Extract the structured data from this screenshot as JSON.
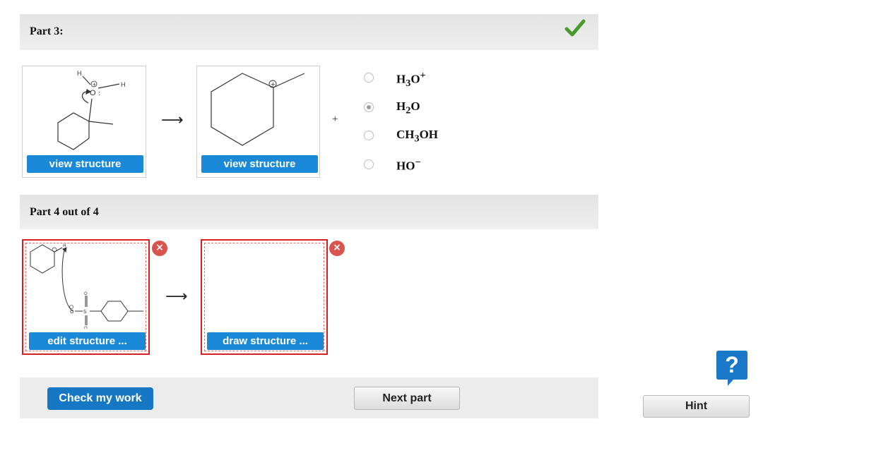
{
  "part3": {
    "title": "Part 3:",
    "reactant_button": "view structure",
    "product_button": "view structure",
    "arrow": "⟶",
    "plus": "+",
    "options": [
      {
        "base": "H",
        "sub": "3",
        "rest": "O",
        "sup": "+",
        "selected": false
      },
      {
        "base": "H",
        "sub": "2",
        "rest": "O",
        "sup": "",
        "selected": true
      },
      {
        "base": "CH",
        "sub": "3",
        "rest": "OH",
        "sup": "",
        "selected": false
      },
      {
        "base": "HO",
        "sub": "",
        "rest": "",
        "sup": "−",
        "selected": false
      }
    ]
  },
  "part4": {
    "title": "Part 4 out of 4",
    "edit_button": "edit structure ...",
    "draw_button": "draw structure ...",
    "arrow": "⟶",
    "remove_icon": "×"
  },
  "footer": {
    "check_button": "Check my work",
    "next_button": "Next part",
    "hint_button": "Hint",
    "help_icon": "?"
  },
  "colors": {
    "accent": "#1a8ad8",
    "check": "#4a9a2e",
    "error": "#d91f1f"
  }
}
